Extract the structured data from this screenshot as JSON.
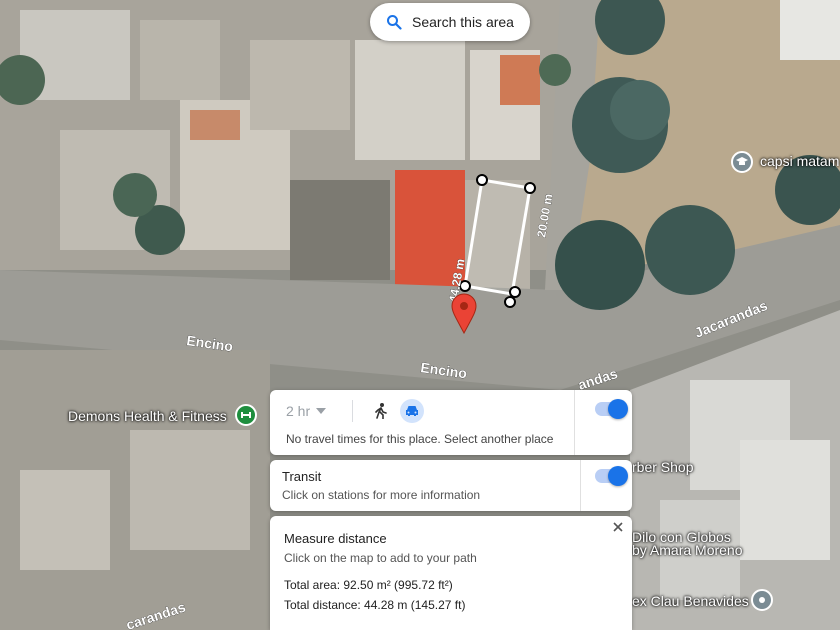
{
  "search_area": {
    "label": "Search this area"
  },
  "map_labels": {
    "encino_left": "Encino",
    "encino_center": "Encino",
    "jacarandas_right": "Jacarandas",
    "jacarandas_mid": "andas",
    "jacarandas_bottom": "carandas",
    "measure_side_a": "44.28 m",
    "measure_side_b": "20.00 m"
  },
  "pois": {
    "demons": "Demons Health & Fitness",
    "capsi": "capsi matam",
    "barber": "rber Shop",
    "globos_line1": "Dilo con Globos",
    "globos_line2": "by Amara Moreno",
    "clau": "ex Clau Benavides"
  },
  "travel": {
    "duration": "2 hr",
    "message": "No travel times for this place. Select another place",
    "walk_icon": "walk-icon",
    "car_icon": "car-icon",
    "toggle_on": true
  },
  "transit": {
    "title": "Transit",
    "subtitle": "Click on stations for more information",
    "toggle_on": true
  },
  "measure": {
    "title": "Measure distance",
    "instruction": "Click on the map to add to your path",
    "total_area": "Total area: 92.50 m² (995.72 ft²)",
    "total_distance": "Total distance: 44.28 m (145.27 ft)",
    "close_icon": "close-icon"
  },
  "colors": {
    "accent": "#1a73e8",
    "pin": "#ea4335",
    "poi_green": "#1e8e3e",
    "poi_gray": "#7b8c94"
  }
}
